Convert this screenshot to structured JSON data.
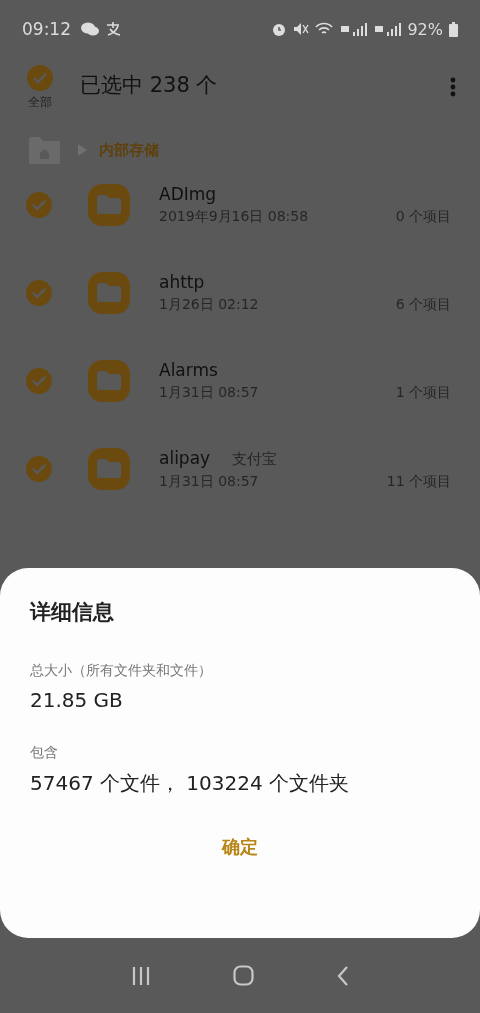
{
  "status_bar": {
    "time": "09:12",
    "battery": "92%"
  },
  "header": {
    "select_all": {
      "label": "全部",
      "checked": true
    },
    "title": "已选中 238 个"
  },
  "breadcrumb": {
    "path": "内部存储"
  },
  "files": [
    {
      "name": "ADImg",
      "date": "2019年9月16日 08:58",
      "count": "0 个项目",
      "selected": true
    },
    {
      "name": "ahttp",
      "date": "1月26日 02:12",
      "count": "6 个项目",
      "selected": true
    },
    {
      "name": "Alarms",
      "date": "1月31日 08:57",
      "count": "1 个项目",
      "selected": true
    },
    {
      "name": "alipay",
      "note": "支付宝",
      "date": "1月31日 08:57",
      "count": "11 个项目",
      "selected": true
    }
  ],
  "dialog": {
    "title": "详细信息",
    "sections": [
      {
        "label": "总大小（所有文件夹和文件）",
        "value": "21.85 GB"
      },
      {
        "label": "包含",
        "value": "57467 个文件， 103224 个文件夹"
      }
    ],
    "button": "确定"
  }
}
